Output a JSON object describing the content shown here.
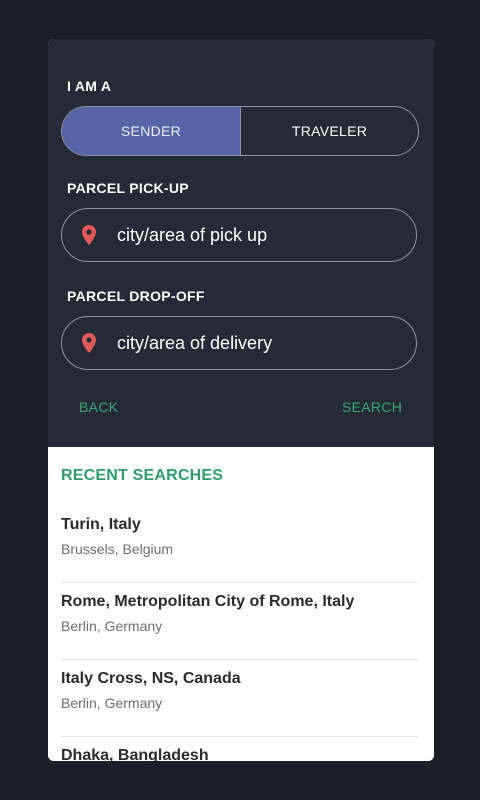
{
  "form": {
    "role_label": "I AM A",
    "role_options": [
      "SENDER",
      "TRAVELER"
    ],
    "selected_role": "SENDER",
    "pickup_label": "PARCEL PICK-UP",
    "pickup_placeholder": "city/area of pick up",
    "dropoff_label": "PARCEL DROP-OFF",
    "dropoff_placeholder": "city/area of delivery",
    "back_label": "BACK",
    "search_label": "SEARCH"
  },
  "recent": {
    "title": "RECENT SEARCHES",
    "items": [
      {
        "to": "Turin, Italy",
        "from": "Brussels, Belgium"
      },
      {
        "to": "Rome, Metropolitan City of Rome, Italy",
        "from": "Berlin, Germany"
      },
      {
        "to": "Italy Cross, NS, Canada",
        "from": "Berlin, Germany"
      },
      {
        "to": "Dhaka, Bangladesh",
        "from": ""
      }
    ]
  },
  "colors": {
    "background": "#1b1f27",
    "panel": "#262a36",
    "active_toggle": "#5864a8",
    "accent_green": "#33a877",
    "pin_red": "#e05a5a"
  },
  "icons": {
    "pickup": "location-pin-icon",
    "dropoff": "location-pin-icon"
  }
}
